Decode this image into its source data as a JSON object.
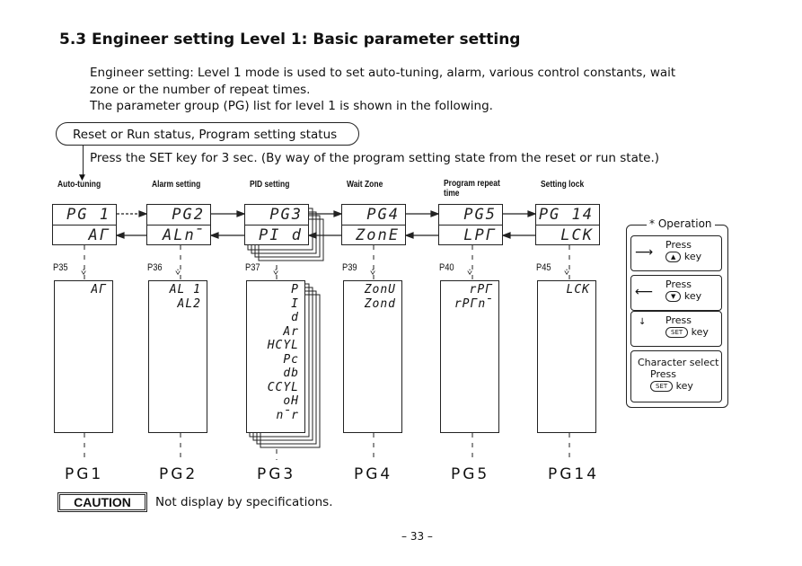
{
  "title": "5.3 Engineer setting  Level 1: Basic parameter setting",
  "intro": [
    "Engineer setting: Level 1 mode is used to set auto-tuning, alarm, various control constants, wait",
    "zone or the number of repeat times.",
    "The parameter group (PG) list for level 1 is shown in the following."
  ],
  "status_box": "Reset or Run status,  Program setting status",
  "press_set": "Press the SET key for 3 sec.  (By way of the program setting state from the reset or run state.)",
  "columns": [
    {
      "head": "Auto-tuning",
      "top": "PG 1",
      "bottom": "AГ",
      "page": "P35",
      "params": [
        "AГ"
      ],
      "pg": "PG1"
    },
    {
      "head": "Alarm setting",
      "top": "PG2",
      "bottom": "ALn̄",
      "page": "P36",
      "params": [
        "AL 1",
        "AL2"
      ],
      "pg": "PG2"
    },
    {
      "head": "PID setting",
      "top": "PG3",
      "bottom": "PI d",
      "page": "P37",
      "params": [
        "P",
        "I",
        "d",
        "Ar",
        "HCYL",
        "Pc",
        "db",
        "CCYL",
        "oH",
        "n̄r"
      ],
      "pg": "PG3"
    },
    {
      "head": "Wait Zone",
      "top": "PG4",
      "bottom": "ZonE",
      "page": "P39",
      "params": [
        "ZonU",
        "Zond"
      ],
      "pg": "PG4"
    },
    {
      "head": "Program repeat time",
      "top": "PG5",
      "bottom": "LPГ",
      "page": "P40",
      "params": [
        "rPГ",
        "rPГn̄"
      ],
      "pg": "PG5"
    },
    {
      "head": "Setting lock",
      "top": "PG 14",
      "bottom": "LCK",
      "page": "P45",
      "params": [
        "LCK"
      ],
      "pg": "PG14"
    }
  ],
  "operation": {
    "title": "* Operation",
    "items": [
      {
        "label": "Press",
        "key": "▲",
        "suffix": "key"
      },
      {
        "label": "Press",
        "key": "▼",
        "suffix": "key"
      },
      {
        "label": "Press",
        "key": "SET",
        "suffix": "key"
      },
      {
        "label": "Character select",
        "label2": "Press",
        "key": "SET",
        "suffix": "key"
      }
    ]
  },
  "caution": {
    "label": "CAUTION",
    "text": "Not display by specifications."
  },
  "page_number": "– 33 –"
}
